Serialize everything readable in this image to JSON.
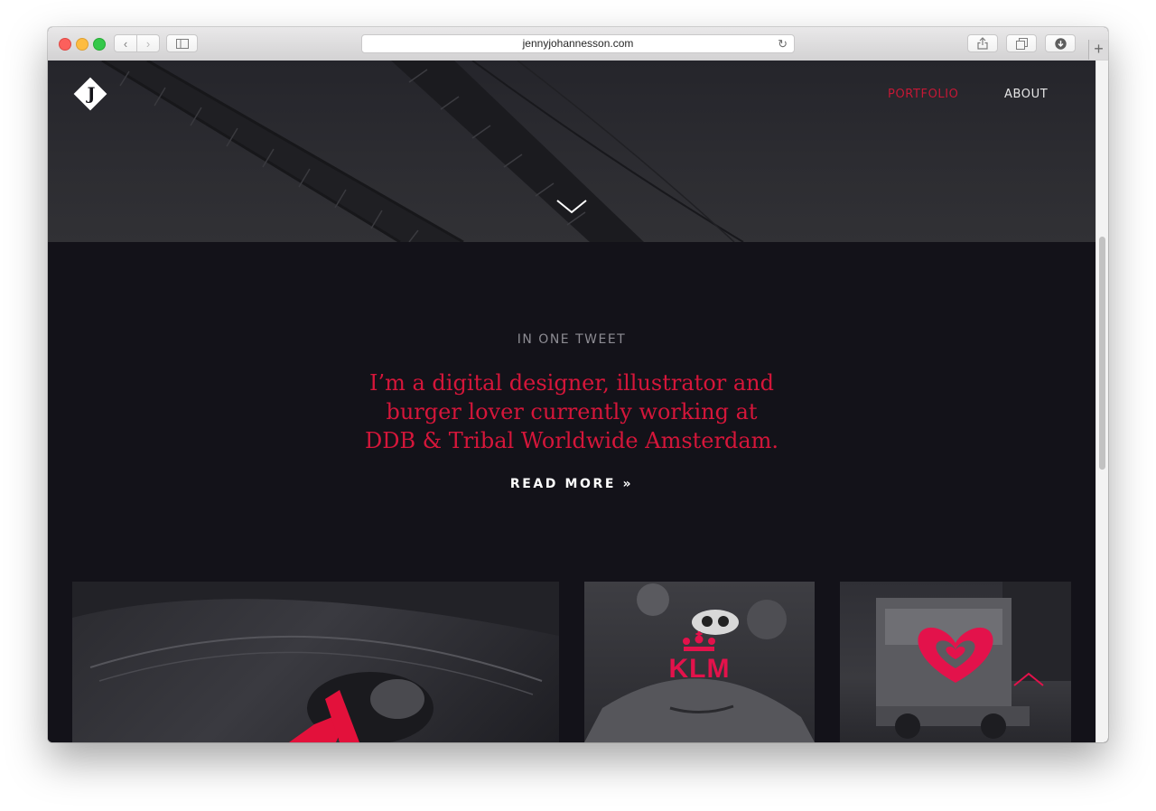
{
  "browser": {
    "url": "jennyjohannesson.com",
    "new_tab_label": "+"
  },
  "site": {
    "logo_letter": "J",
    "nav": [
      {
        "label": "PORTFOLIO",
        "active": true
      },
      {
        "label": "ABOUT",
        "active": false
      }
    ]
  },
  "intro": {
    "kicker": "IN ONE TWEET",
    "tweet_lines": [
      "I’m a digital designer, illustrator and",
      "burger lover currently working at",
      "DDB & Tribal Worldwide Amsterdam."
    ],
    "read_more": "READ MORE »"
  },
  "portfolio": {
    "cards": [
      {
        "brand": "eye illustration",
        "logo_text": ""
      },
      {
        "brand": "KLM",
        "logo_text": "KLM"
      },
      {
        "brand": "heart ice cream",
        "logo_text": ""
      }
    ]
  },
  "colors": {
    "accent": "#d5163a",
    "nav_active": "#c51835",
    "page_bg": "#131219",
    "hero_bg": "#2c2c31"
  },
  "icons": {
    "chevron_down": "chevron-down-icon",
    "scroll_top": "chevron-up-icon",
    "reload": "reload-icon"
  }
}
